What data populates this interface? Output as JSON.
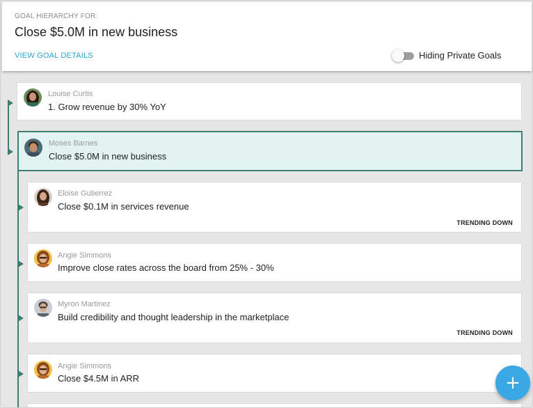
{
  "header": {
    "label": "GOAL HIERARCHY FOR:",
    "title": "Close $5.0M in new business",
    "details_link": "VIEW GOAL DETAILS",
    "toggle_label": "Hiding Private Goals",
    "toggle_on": false
  },
  "goals": [
    {
      "owner": "Louise Curtis",
      "title": "1. Grow revenue by 30% YoY",
      "trend": "",
      "avatar_icon": "avatar-photo"
    },
    {
      "owner": "Moses Barnes",
      "title": "Close $5.0M in new business",
      "trend": "",
      "selected": true,
      "avatar_icon": "avatar-photo"
    },
    {
      "owner": "Eloise Gutierrez",
      "title": "Close $0.1M in services revenue",
      "trend": "TRENDING DOWN",
      "avatar_icon": "avatar-photo"
    },
    {
      "owner": "Angie Simmons",
      "title": "Improve close rates across the board from 25% - 30%",
      "trend": "",
      "avatar_icon": "avatar-photo"
    },
    {
      "owner": "Myron Martinez",
      "title": "Build credibility and thought leadership in the marketplace",
      "trend": "TRENDING DOWN",
      "avatar_icon": "avatar-photo"
    },
    {
      "owner": "Angie Simmons",
      "title": "Close $4.5M in ARR",
      "trend": "",
      "avatar_icon": "avatar-photo"
    }
  ],
  "fab": {
    "icon": "plus-icon",
    "label": "+"
  },
  "colors": {
    "accent": "#3d7d73",
    "link": "#2aa3d8",
    "fab": "#3aa8e4",
    "selected_bg": "#e3f3f1"
  }
}
